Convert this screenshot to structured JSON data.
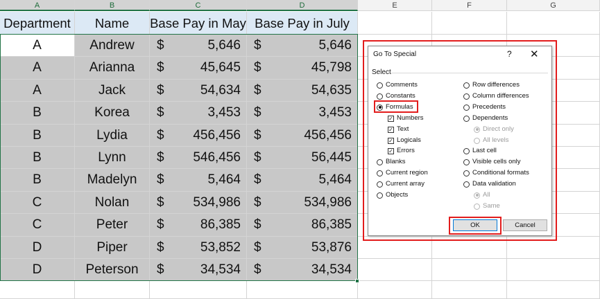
{
  "columns": [
    "A",
    "B",
    "C",
    "D",
    "E",
    "F",
    "G"
  ],
  "table": {
    "headers": [
      "Department",
      "Name",
      "Base Pay in May",
      "Base Pay in July"
    ],
    "currency": "$",
    "rows": [
      {
        "dept": "A",
        "name": "Andrew",
        "may": "5,646",
        "july": "5,646"
      },
      {
        "dept": "A",
        "name": "Arianna",
        "may": "45,645",
        "july": "45,798"
      },
      {
        "dept": "A",
        "name": "Jack",
        "may": "54,634",
        "july": "54,635"
      },
      {
        "dept": "B",
        "name": "Korea",
        "may": "3,453",
        "july": "3,453"
      },
      {
        "dept": "B",
        "name": "Lydia",
        "may": "456,456",
        "july": "456,456"
      },
      {
        "dept": "B",
        "name": "Lynn",
        "may": "546,456",
        "july": "56,445"
      },
      {
        "dept": "B",
        "name": "Madelyn",
        "may": "5,464",
        "july": "5,464"
      },
      {
        "dept": "C",
        "name": "Nolan",
        "may": "534,986",
        "july": "534,986"
      },
      {
        "dept": "C",
        "name": "Peter",
        "may": "86,385",
        "july": "86,385"
      },
      {
        "dept": "D",
        "name": "Piper",
        "may": "53,852",
        "july": "53,876"
      },
      {
        "dept": "D",
        "name": "Peterson",
        "may": "34,534",
        "july": "34,534"
      }
    ]
  },
  "dialog": {
    "title": "Go To Special",
    "help": "?",
    "close": "✕",
    "group_label": "Select",
    "left_options": {
      "comments": "Comments",
      "constants": "Constants",
      "formulas": "Formulas",
      "numbers": "Numbers",
      "text": "Text",
      "logicals": "Logicals",
      "errors": "Errors",
      "blanks": "Blanks",
      "current_region": "Current region",
      "current_array": "Current array",
      "objects": "Objects"
    },
    "right_options": {
      "row_differences": "Row differences",
      "column_differences": "Column differences",
      "precedents": "Precedents",
      "dependents": "Dependents",
      "direct_only": "Direct only",
      "all_levels": "All levels",
      "last_cell": "Last cell",
      "visible_cells_only": "Visible cells only",
      "conditional_formats": "Conditional formats",
      "data_validation": "Data validation",
      "all": "All",
      "same": "Same"
    },
    "selected_option": "Formulas",
    "checked": [
      "Numbers",
      "Text",
      "Logicals",
      "Errors"
    ],
    "ok_label": "OK",
    "cancel_label": "Cancel"
  },
  "colors": {
    "selection_fill": "#c8c8c8",
    "header_fill": "#dce9f5",
    "selection_border": "#217346",
    "highlight": "#e21c1c"
  }
}
